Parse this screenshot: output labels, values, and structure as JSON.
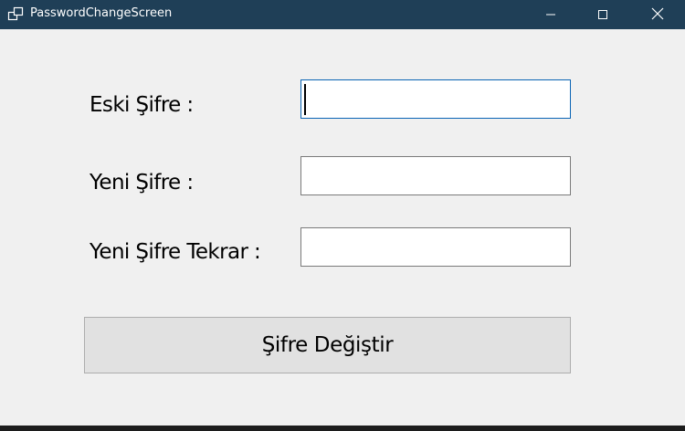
{
  "window": {
    "title": "PasswordChangeScreen",
    "icon": "app-window-icon",
    "controls": [
      "minimize-icon",
      "maximize-icon",
      "close-icon"
    ]
  },
  "form": {
    "old_password_label": "Eski Şifre :",
    "old_password_value": "",
    "new_password_label": "Yeni Şifre :",
    "new_password_value": "",
    "confirm_password_label": "Yeni Şifre Tekrar :",
    "confirm_password_value": "",
    "submit_label": "Şifre Değiştir"
  },
  "colors": {
    "titlebar": "#1f3f57",
    "background": "#f0f0f0",
    "button": "#e1e1e1",
    "focus_border": "#0a64b4"
  }
}
